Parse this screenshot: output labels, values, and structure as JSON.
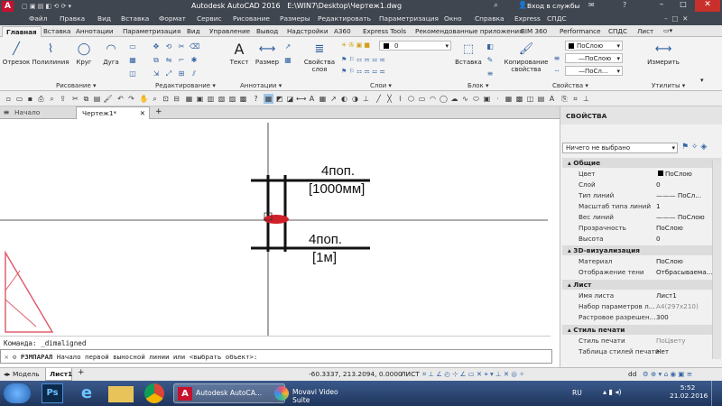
{
  "window": {
    "app_title": "Autodesk AutoCAD 2016",
    "file_path": "E:\\WIN7\\Desktop\\Чертеж1.dwg",
    "signin_label": "Вход в службы",
    "logo_letter": "A"
  },
  "menu": [
    "Файл",
    "Правка",
    "Вид",
    "Вставка",
    "Формат",
    "Сервис",
    "Рисование",
    "Размеры",
    "Редактировать",
    "Параметризация",
    "Окно",
    "Справка",
    "Express",
    "СПДС"
  ],
  "ribbon_tabs": [
    "Главная",
    "Вставка",
    "Аннотации",
    "Параметризация",
    "Вид",
    "Управление",
    "Вывод",
    "Надстройки",
    "A360",
    "Express Tools",
    "Рекомендованные приложения",
    "BIM 360",
    "Performance",
    "СПДС",
    "Лист"
  ],
  "ribbon": {
    "draw_tools": [
      "Отрезок",
      "Полилиния",
      "Круг",
      "Дуга"
    ],
    "annot_tools": [
      "Текст",
      "Размер"
    ],
    "layer_props": "Свойства слоя",
    "layer_value": "0",
    "insert": "Вставка",
    "copy_props": "Копирование свойства",
    "measure": "Измерить",
    "prop_color": "ПоСлою",
    "prop_line1": "ПоСлою",
    "prop_line2": "ПоСл...",
    "groups": [
      "Рисование",
      "Редактирование",
      "Аннотации",
      "Слои",
      "Блок",
      "Свойства",
      "Утилиты"
    ]
  },
  "doc_tabs": {
    "start": "Начало",
    "active": "Чертеж1*",
    "add": "+"
  },
  "drawing": {
    "label1_top": "4поп.",
    "label1_bottom": "[1000мм]",
    "label2_top": "4поп.",
    "label2_bottom": "[1м]"
  },
  "command": {
    "history": "Команда: _dimaligned",
    "prompt_cmd": "РЗМПАРАЛ",
    "prompt_text": "Начало первой выносной линии или <выбрать объект>:"
  },
  "layout_tabs": [
    "Модель",
    "Лист1",
    "+"
  ],
  "status": {
    "coords": "-60.3337, 213.2094, 0.0000",
    "space": "ЛИСТ",
    "dd": "dd"
  },
  "properties": {
    "title": "СВОЙСТВА",
    "selector": "Ничего не выбрано",
    "sections": [
      {
        "name": "Общие",
        "rows": [
          {
            "k": "Цвет",
            "v": "ПоСлою",
            "swatch": true
          },
          {
            "k": "Слой",
            "v": "0"
          },
          {
            "k": "Тип линий",
            "v": "——— ПоСл..."
          },
          {
            "k": "Масштаб типа линий",
            "v": "1"
          },
          {
            "k": "Вес линий",
            "v": "——— ПоСлою"
          },
          {
            "k": "Прозрачность",
            "v": "ПоСлою"
          },
          {
            "k": "Высота",
            "v": "0"
          }
        ]
      },
      {
        "name": "3D-визуализация",
        "rows": [
          {
            "k": "Материал",
            "v": "ПоСлою"
          },
          {
            "k": "Отображение тени",
            "v": "Отбрасываема..."
          }
        ]
      },
      {
        "name": "Лист",
        "rows": [
          {
            "k": "Имя листа",
            "v": "Лист1"
          },
          {
            "k": "Набор параметров л...",
            "v": "A4(297x210)"
          },
          {
            "k": "Растровое разрешен...",
            "v": "300"
          }
        ]
      },
      {
        "name": "Стиль печати",
        "rows": [
          {
            "k": "Стиль печати",
            "v": "ПоЦвету"
          },
          {
            "k": "Таблица стилей печати",
            "v": "Нет"
          }
        ]
      }
    ]
  },
  "taskbar": {
    "app1": "Autodesk AutoCA...",
    "app2": "Movavi Video Suite",
    "lang": "RU",
    "time": "5:52",
    "date": "21.02.2016"
  },
  "colors": {
    "accent": "#3f4650",
    "selection": "#d0202a",
    "autocad_red": "#c8102e"
  }
}
